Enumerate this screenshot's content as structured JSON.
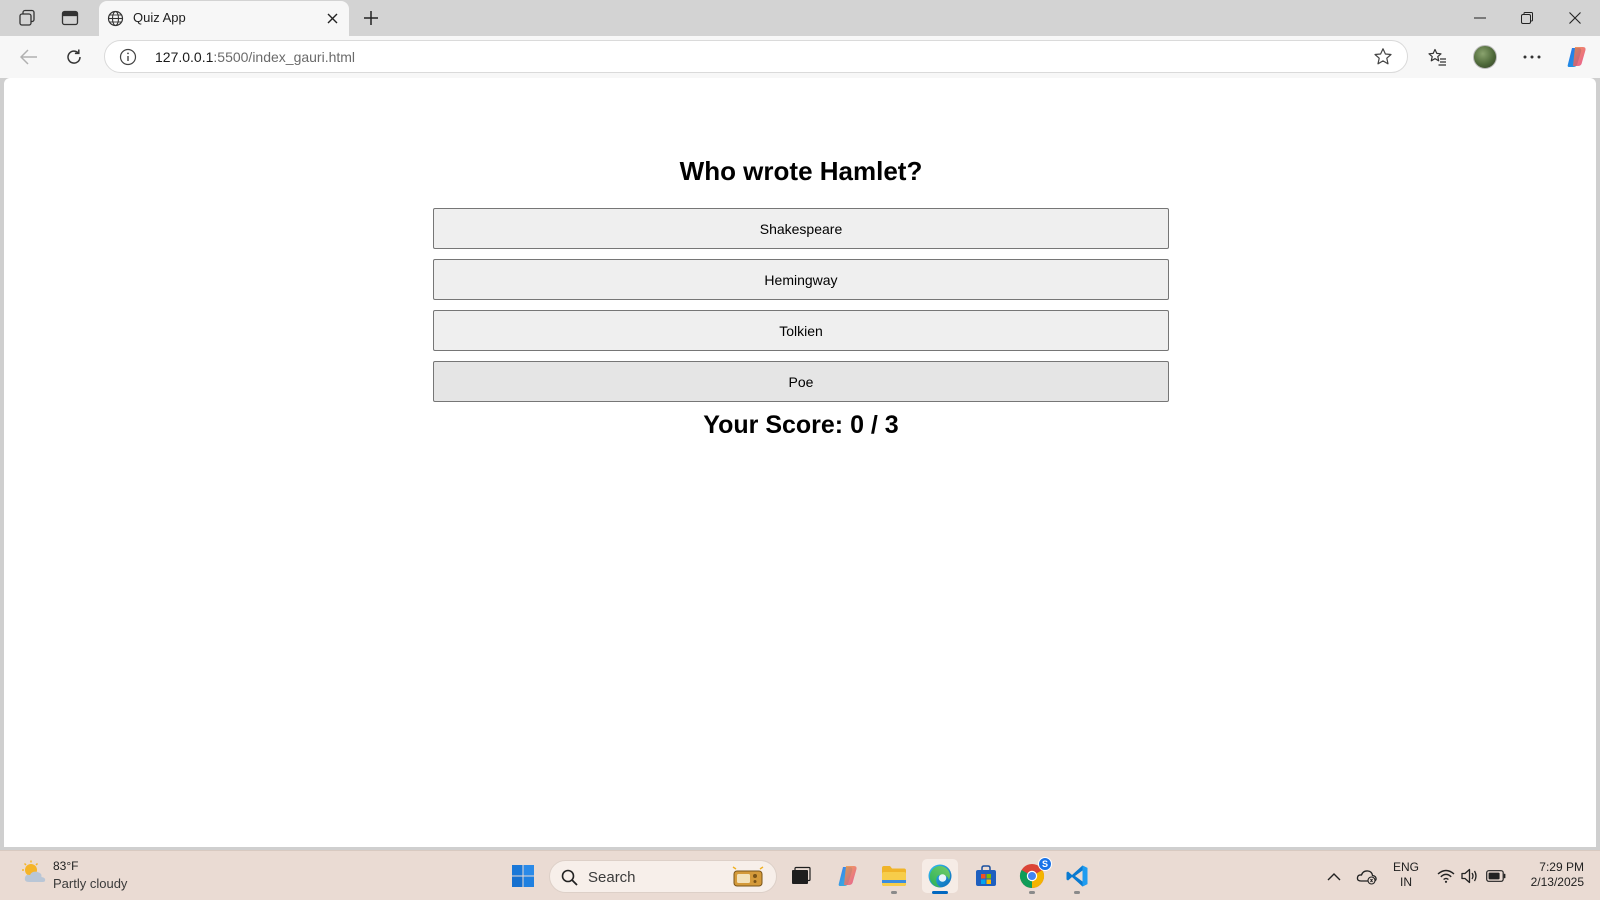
{
  "browser": {
    "tab_title": "Quiz App",
    "url_host": "127.0.0.1",
    "url_path": ":5500/index_gauri.html"
  },
  "quiz": {
    "question": "Who wrote Hamlet?",
    "answers": [
      "Shakespeare",
      "Hemingway",
      "Tolkien",
      "Poe"
    ],
    "score_text": "Your Score: 0 / 3"
  },
  "taskbar": {
    "weather_temp": "83°F",
    "weather_desc": "Partly cloudy",
    "search_placeholder": "Search",
    "chrome_badge": "S",
    "lang_line1": "ENG",
    "lang_line2": "IN",
    "time": "7:29 PM",
    "date": "2/13/2025"
  },
  "icons": {
    "tab_actions": "tab-actions-icon",
    "vertical_tabs": "vertical-tabs-icon",
    "globe": "globe-icon",
    "accent": "#0067c0"
  }
}
